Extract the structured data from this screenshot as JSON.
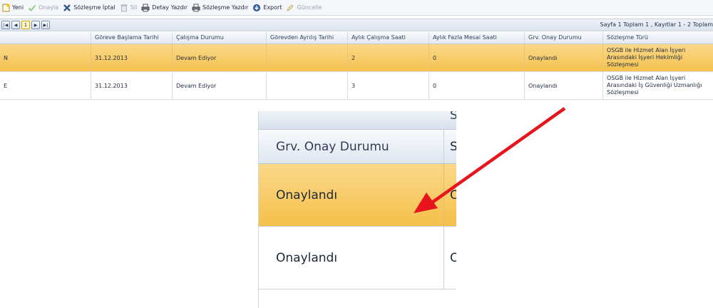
{
  "toolbar": {
    "new": "Yeni",
    "approve": "Onayla",
    "cancel_contract": "Sözleşme İptal",
    "delete": "Sil",
    "print_detail": "Detay Yazdır",
    "print_contract": "Sözleşme Yazdır",
    "export": "Export",
    "update": "Güncelle"
  },
  "pager": {
    "current_page": "1",
    "info": "Sayfa 1 Toplam 1 , Kayıtlar 1 - 2 Toplam"
  },
  "grid": {
    "columns": [
      "",
      "Göreve Başlama Tarihi",
      "Çalışma Durumu",
      "Görevden Ayrılış Tarihi",
      "Aylık Çalışma Saati",
      "Aylık Fazla Mesai Saati",
      "Grv. Onay Durumu",
      "Sözleşme Türü"
    ],
    "rows": [
      {
        "name_fragment": "N",
        "start_date": "31.12.2013",
        "status": "Devam Ediyor",
        "leave_date": "",
        "monthly_hours": "2",
        "overtime_hours": "0",
        "approval": "Onaylandı",
        "contract_type": "OSGB ile Hizmet Alan İşyeri Arasındaki İşyeri Hekimliği Sözleşmesi",
        "selected": true
      },
      {
        "name_fragment": "E",
        "start_date": "31.12.2013",
        "status": "Devam Ediyor",
        "leave_date": "",
        "monthly_hours": "3",
        "overtime_hours": "0",
        "approval": "Onaylandı",
        "contract_type": "OSGB ile Hizmet Alan İşyeri Arasındaki İş Güvenliği Uzmanlığı Sözleşmesi",
        "selected": false
      }
    ]
  },
  "zoom": {
    "header": "Grv. Onay Durumu",
    "header_cut": "S",
    "pager_cut": "S",
    "row1_value": "Onaylandı",
    "row1_cut": "O",
    "row2_value": "Onaylandı",
    "row2_cut": "O"
  },
  "colors": {
    "selected_row": "#f5c24f",
    "arrow": "#e8141b",
    "header_bg": "#e3e9f1"
  }
}
